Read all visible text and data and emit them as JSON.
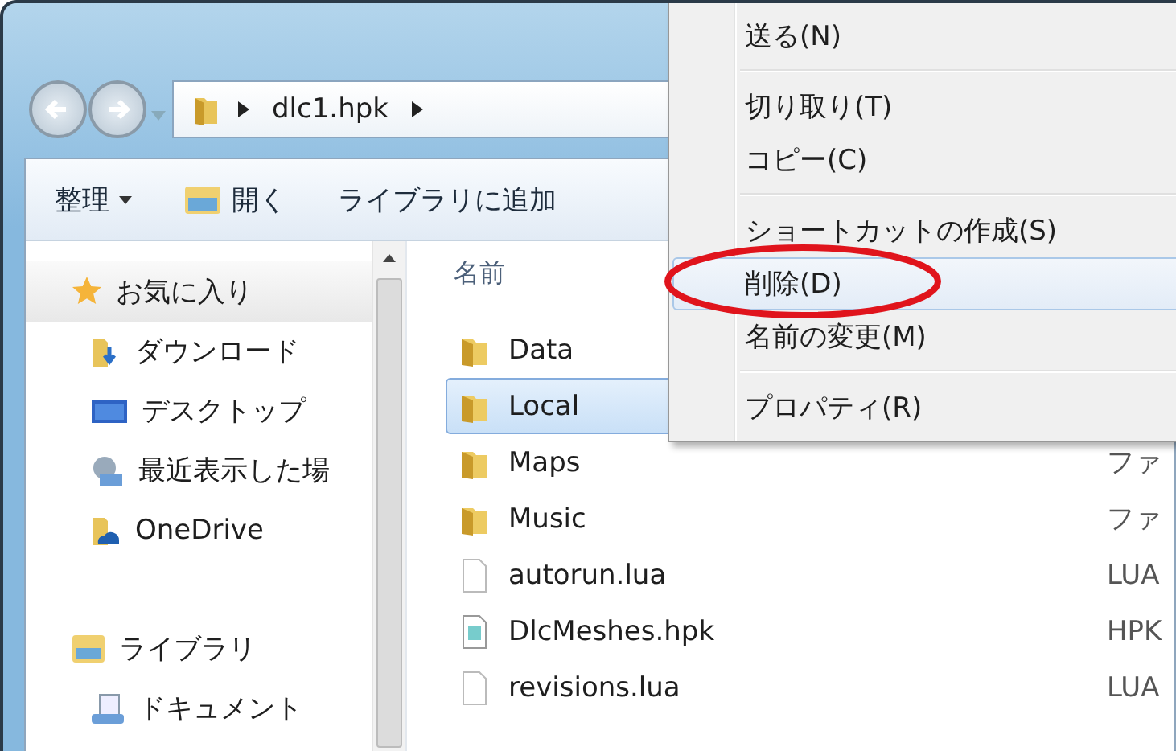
{
  "address_bar": {
    "segments": [
      "dlc1.hpk"
    ]
  },
  "toolbar": {
    "items": [
      {
        "label": "整理",
        "kind": "dropdown"
      },
      {
        "label": "開く",
        "kind": "open"
      },
      {
        "label": "ライブラリに追加",
        "kind": "plain"
      }
    ]
  },
  "sidebar": {
    "groups": [
      {
        "label": "お気に入り",
        "kind": "star",
        "selected": true,
        "children": [
          {
            "label": "ダウンロード",
            "kind": "download",
            "selected": false
          },
          {
            "label": "デスクトップ",
            "kind": "desktop",
            "selected": false
          },
          {
            "label": "最近表示した場",
            "kind": "recent",
            "selected": false
          },
          {
            "label": "OneDrive",
            "kind": "cloud",
            "selected": false
          }
        ]
      },
      {
        "label": "ライブラリ",
        "kind": "library",
        "selected": false,
        "children": [
          {
            "label": "ドキュメント",
            "kind": "document",
            "selected": false
          }
        ]
      }
    ]
  },
  "file_list": {
    "columns": [
      {
        "label": "名前"
      }
    ],
    "rows": [
      {
        "name": "Data",
        "kind": "folder",
        "selected": false
      },
      {
        "name": "Local",
        "kind": "folder",
        "selected": true
      },
      {
        "name": "Maps",
        "kind": "folder",
        "selected": false,
        "type": "ファ"
      },
      {
        "name": "Music",
        "kind": "folder",
        "selected": false,
        "type": "ファ"
      },
      {
        "name": "autorun.lua",
        "kind": "file",
        "selected": false,
        "type": "LUA"
      },
      {
        "name": "DlcMeshes.hpk",
        "kind": "archive",
        "selected": false,
        "type": "HPK"
      },
      {
        "name": "revisions.lua",
        "kind": "file",
        "selected": false,
        "type": "LUA"
      }
    ]
  },
  "context_menu": {
    "groups": [
      [
        {
          "label": "送る(N)",
          "selected": false,
          "circled": false
        }
      ],
      [
        {
          "label": "切り取り(T)",
          "selected": false,
          "circled": false
        },
        {
          "label": "コピー(C)",
          "selected": false,
          "circled": false
        }
      ],
      [
        {
          "label": "ショートカットの作成(S)",
          "selected": false,
          "circled": false
        },
        {
          "label": "削除(D)",
          "selected": true,
          "circled": true
        },
        {
          "label": "名前の変更(M)",
          "selected": false,
          "circled": false
        }
      ],
      [
        {
          "label": "プロパティ(R)",
          "selected": false,
          "circled": false
        }
      ]
    ]
  }
}
